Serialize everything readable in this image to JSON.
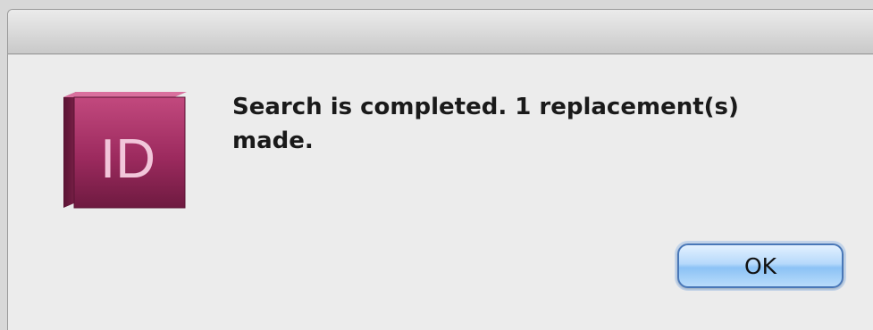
{
  "dialog": {
    "message": "Search is completed. 1 replacement(s) made.",
    "ok_label": "OK"
  },
  "app_icon": {
    "name": "indesign-icon",
    "text": "ID",
    "color": "#8a1f4f"
  }
}
